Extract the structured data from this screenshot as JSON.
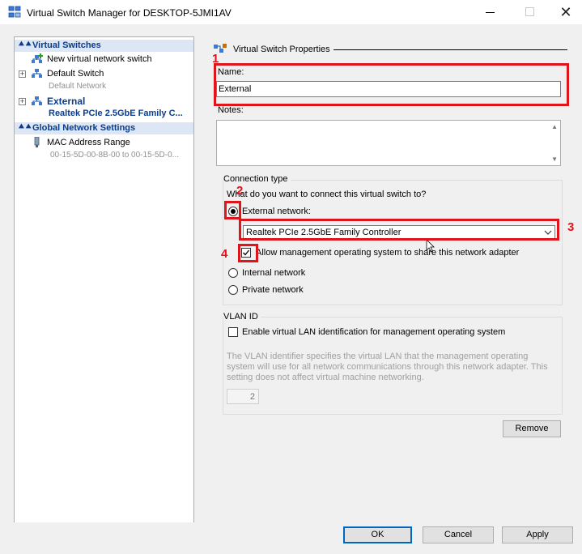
{
  "window": {
    "title": "Virtual Switch Manager for DESKTOP-5JMI1AV",
    "close_glyph": "✕"
  },
  "tree": {
    "virtual_switches_header": "Virtual Switches",
    "new_switch": "New virtual network switch",
    "default_switch": {
      "name": "Default Switch",
      "type": "Default Network"
    },
    "external": {
      "name": "External",
      "adapter": "Realtek PCIe 2.5GbE Family C..."
    },
    "global_header": "Global Network Settings",
    "mac": {
      "name": "MAC Address Range",
      "range": "00-15-5D-00-8B-00 to 00-15-5D-0..."
    }
  },
  "properties": {
    "title": "Virtual Switch Properties",
    "name_label": "Name:",
    "name_value": "External",
    "notes_label": "Notes:",
    "connection_type_label": "Connection type",
    "connection_question": "What do you want to connect this virtual switch to?",
    "external_network": "External network:",
    "external_network_selected": true,
    "adapter_selected": "Realtek PCIe 2.5GbE Family Controller",
    "allow_management": "Allow management operating system to share this network adapter",
    "allow_management_checked": true,
    "internal_network": "Internal network",
    "private_network": "Private network",
    "vlan_label": "VLAN ID",
    "vlan_enable": "Enable virtual LAN identification for management operating system",
    "vlan_description": "The VLAN identifier specifies the virtual LAN that the management operating system will use for all network communications through this network adapter. This setting does not affect virtual machine networking.",
    "vlan_value": "2",
    "remove_button": "Remove"
  },
  "buttons": {
    "ok": "OK",
    "cancel": "Cancel",
    "apply": "Apply"
  },
  "annotations": {
    "n1": "1",
    "n2": "2",
    "n3": "3",
    "n4": "4",
    "color": "#e0151b"
  }
}
